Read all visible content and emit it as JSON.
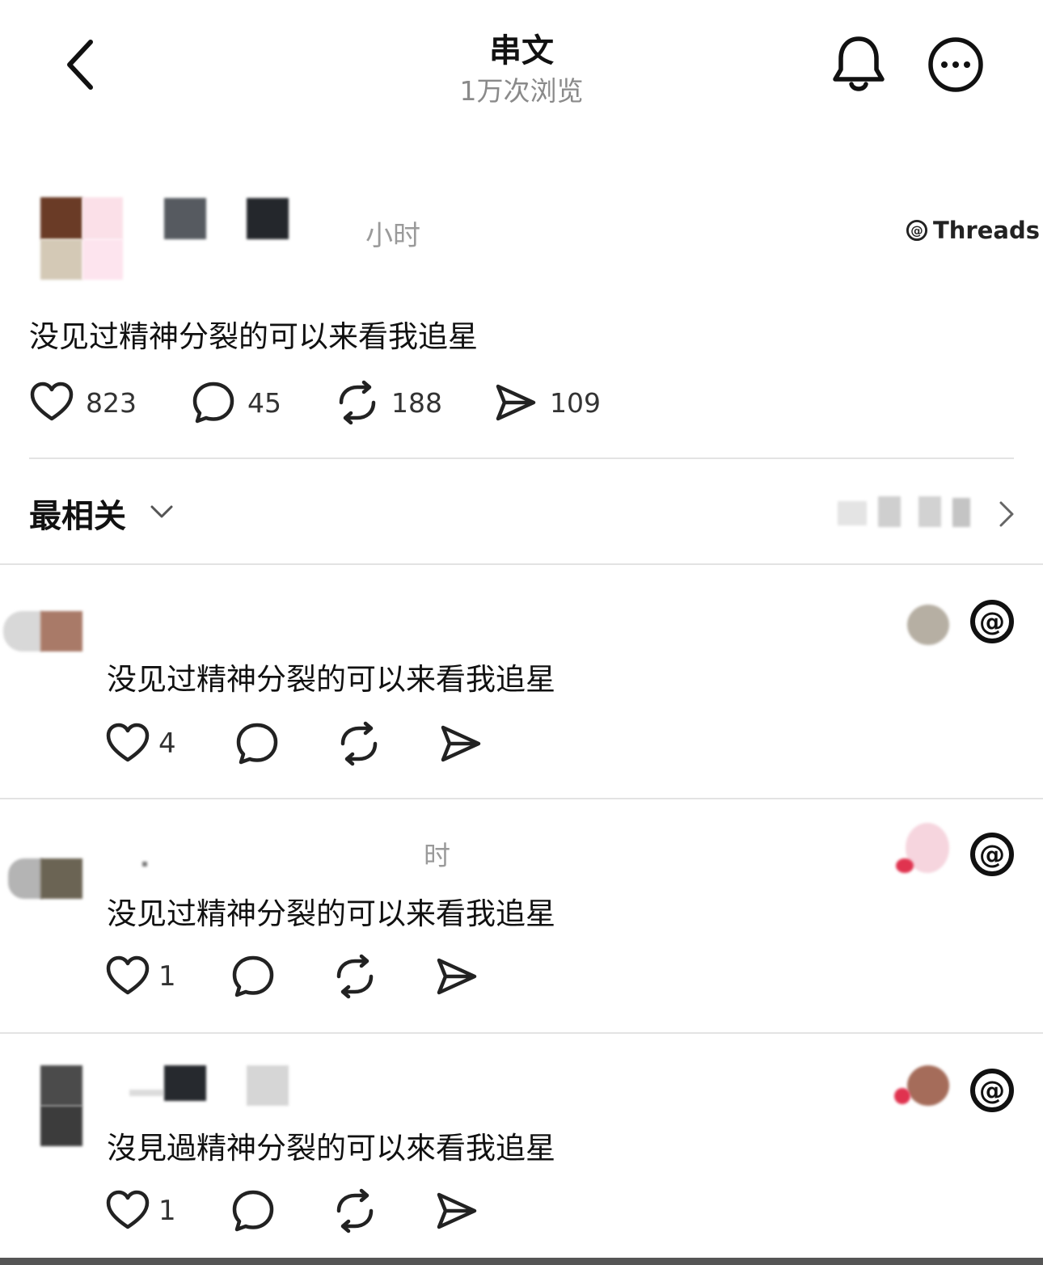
{
  "header": {
    "title": "串文",
    "views": "1万次浏览",
    "back_icon": "chevron-left-icon",
    "bell_icon": "bell-icon",
    "more_icon": "more-horizontal-icon"
  },
  "post": {
    "time": "小时",
    "badge": "Threads",
    "text": "没见过精神分裂的可以来看我追星",
    "stats": {
      "likes": "823",
      "comments": "45",
      "reposts": "188",
      "shares": "109"
    }
  },
  "sort": {
    "label": "最相关"
  },
  "replies": [
    {
      "text": "没见过精神分裂的可以来看我追星",
      "likes": "4",
      "time": ""
    },
    {
      "text": "没见过精神分裂的可以来看我追星",
      "likes": "1",
      "time": "时"
    },
    {
      "text": "沒見過精神分裂的可以來看我追星",
      "likes": "1",
      "time": ""
    }
  ],
  "colors": {
    "text": "#111111",
    "muted": "#8a8a8a",
    "divider": "#e3e3e3",
    "background": "#ffffff"
  }
}
